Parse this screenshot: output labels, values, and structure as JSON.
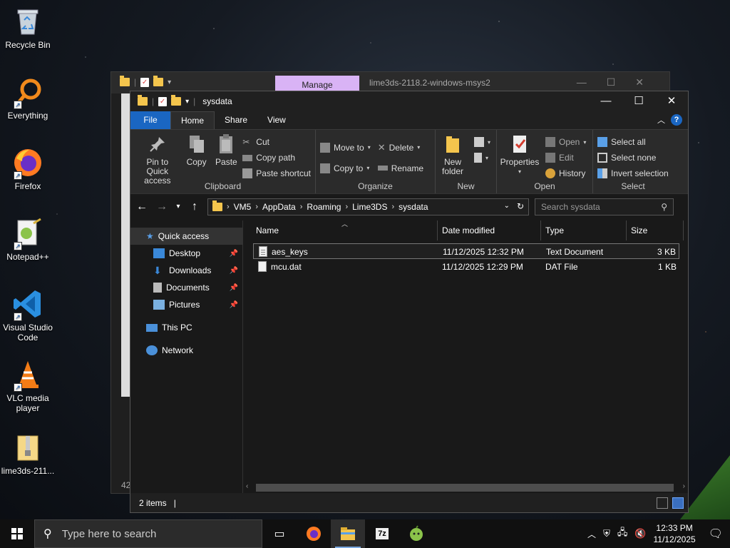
{
  "desktop": {
    "icons": [
      {
        "label": "Recycle Bin"
      },
      {
        "label": "Everything"
      },
      {
        "label": "Firefox"
      },
      {
        "label": "Notepad++"
      },
      {
        "label": "Visual Studio Code"
      },
      {
        "label": "VLC media player"
      },
      {
        "label": "lime3ds-211..."
      }
    ]
  },
  "bg_window": {
    "context_tab": "Manage",
    "title": "lime3ds-2118.2-windows-msys2",
    "status_count": "42"
  },
  "window": {
    "title": "sysdata",
    "tabs": [
      "File",
      "Home",
      "Share",
      "View"
    ],
    "active_tab": "Home"
  },
  "ribbon": {
    "clipboard": {
      "pin_label": "Pin to Quick access",
      "copy_label": "Copy",
      "paste_label": "Paste",
      "cut_label": "Cut",
      "copy_path_label": "Copy path",
      "paste_shortcut_label": "Paste shortcut",
      "group_label": "Clipboard"
    },
    "organize": {
      "move_to_label": "Move to",
      "copy_to_label": "Copy to",
      "delete_label": "Delete",
      "rename_label": "Rename",
      "group_label": "Organize"
    },
    "new": {
      "new_folder_label": "New folder",
      "group_label": "New"
    },
    "open": {
      "properties_label": "Properties",
      "open_label": "Open",
      "edit_label": "Edit",
      "history_label": "History",
      "group_label": "Open"
    },
    "select": {
      "select_all_label": "Select all",
      "select_none_label": "Select none",
      "invert_label": "Invert selection",
      "group_label": "Select"
    }
  },
  "address": {
    "crumbs": [
      "VM5",
      "AppData",
      "Roaming",
      "Lime3DS",
      "sysdata"
    ],
    "search_placeholder": "Search sysdata"
  },
  "nav": {
    "items": [
      {
        "label": "Quick access"
      },
      {
        "label": "Desktop"
      },
      {
        "label": "Downloads"
      },
      {
        "label": "Documents"
      },
      {
        "label": "Pictures"
      },
      {
        "label": "This PC"
      },
      {
        "label": "Network"
      }
    ]
  },
  "columns": [
    "Name",
    "Date modified",
    "Type",
    "Size"
  ],
  "files": [
    {
      "name": "aes_keys",
      "date": "11/12/2025 12:32 PM",
      "type": "Text Document",
      "size": "3 KB"
    },
    {
      "name": "mcu.dat",
      "date": "11/12/2025 12:29 PM",
      "type": "DAT File",
      "size": "1 KB"
    }
  ],
  "status": {
    "items_count": "2 items",
    "separator": "|"
  },
  "taskbar": {
    "search_placeholder": "Type here to search",
    "time": "12:33 PM",
    "date": "11/12/2025"
  },
  "colors": {
    "accent": "#1a66c2",
    "manage_tab": "#d9b3f5",
    "folder": "#f4c54d"
  }
}
